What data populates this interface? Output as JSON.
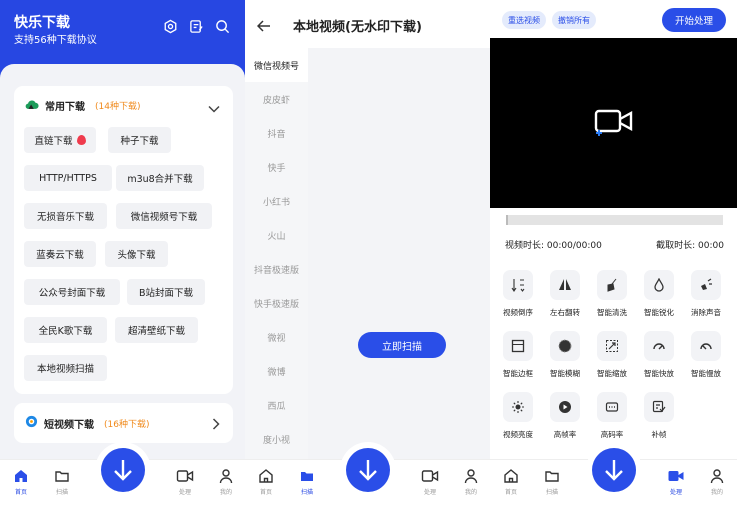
{
  "panel1": {
    "title": "快乐下载",
    "subtitle": "支持56种下载协议",
    "icons": [
      "settings-icon",
      "edit-icon",
      "search-icon"
    ],
    "common": {
      "label": "常用下载",
      "count": "(14种下载)",
      "chips": [
        "直链下载",
        "种子下载",
        "HTTP/HTTPS",
        "m3u8合并下载",
        "无损音乐下载",
        "微信视频号下载",
        "蓝奏云下载",
        "头像下载",
        "公众号封面下载",
        "B站封面下载",
        "全民K歌下载",
        "超清壁纸下载",
        "本地视频扫描"
      ]
    },
    "short": {
      "label": "短视频下载",
      "count": "(16种下载)"
    }
  },
  "panel2": {
    "title": "本地视频(无水印下载)",
    "sidebar": [
      "微信视频号",
      "皮皮虾",
      "抖音",
      "快手",
      "小红书",
      "火山",
      "抖音极速版",
      "快手极速版",
      "微视",
      "微博",
      "西瓜",
      "度小视"
    ],
    "scan_button": "立即扫描"
  },
  "panel3": {
    "reselect": "重选视频",
    "undo_all": "撤销所有",
    "start": "开始处理",
    "duration": "视频时长: 00:00/00:00",
    "cut_duration": "截取时长: 00:00",
    "tools": [
      "视频倒序",
      "左右翻转",
      "智能清洗",
      "智能锐化",
      "消除声音",
      "智能边框",
      "智能模糊",
      "智能缩放",
      "智能快放",
      "智能慢放",
      "视频亮度",
      "高帧率",
      "高码率",
      "补帧"
    ]
  },
  "nav": {
    "home": "首页",
    "scan": "扫描",
    "process": "处理",
    "mine": "我的"
  },
  "colors": {
    "primary": "#2747e2",
    "accent_orange": "#f08a1c",
    "fire_red": "#ef3b4d"
  }
}
